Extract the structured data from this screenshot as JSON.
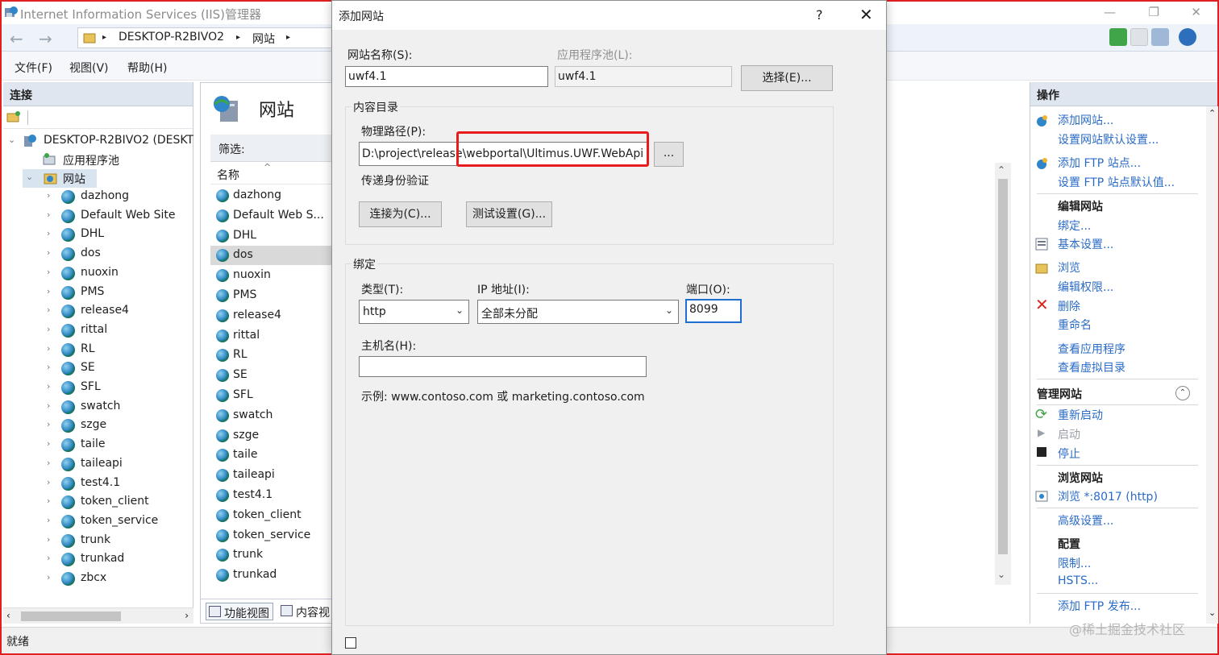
{
  "window": {
    "title": "Internet Information Services (IIS)管理器",
    "min": "—",
    "max": "❐",
    "close": "✕"
  },
  "address": {
    "back": "←",
    "forward": "→",
    "crumbs": [
      "DESKTOP-R2BIVO2",
      "网站"
    ],
    "sep": "▸"
  },
  "menu": [
    "文件(F)",
    "视图(V)",
    "帮助(H)"
  ],
  "connections": {
    "header": "连接",
    "server": "DESKTOP-R2BIVO2 (DESKT",
    "app_pools": "应用程序池",
    "sites_node": "网站",
    "sites": [
      "dazhong",
      "Default Web Site",
      "DHL",
      "dos",
      "nuoxin",
      "PMS",
      "release4",
      "rittal",
      "RL",
      "SE",
      "SFL",
      "swatch",
      "szge",
      "taile",
      "taileapi",
      "test4.1",
      "token_client",
      "token_service",
      "trunk",
      "trunkad",
      "zbcx"
    ]
  },
  "center": {
    "title": "网站",
    "filter_label": "筛选:",
    "column_name": "名称",
    "sites": [
      "dazhong",
      "Default Web S...",
      "DHL",
      "dos",
      "nuoxin",
      "PMS",
      "release4",
      "rittal",
      "RL",
      "SE",
      "SFL",
      "swatch",
      "szge",
      "taile",
      "taileapi",
      "test4.1",
      "token_client",
      "token_service",
      "trunk",
      "trunkad"
    ],
    "selected": "dos",
    "tab_features": "功能视图",
    "tab_content": "内容视"
  },
  "actions": {
    "header": "操作",
    "add_site": "添加网站...",
    "site_defaults": "设置网站默认设置...",
    "add_ftp": "添加 FTP 站点...",
    "ftp_defaults": "设置 FTP 站点默认值...",
    "edit_site": "编辑网站",
    "bindings": "绑定...",
    "basic_settings": "基本设置...",
    "browse": "浏览",
    "edit_permissions": "编辑权限...",
    "delete": "删除",
    "rename": "重命名",
    "view_apps": "查看应用程序",
    "view_vdirs": "查看虚拟目录",
    "manage_site": "管理网站",
    "restart": "重新启动",
    "start": "启动",
    "stop": "停止",
    "browse_site": "浏览网站",
    "browse_8017": "浏览 *:8017 (http)",
    "advanced": "高级设置...",
    "configure": "配置",
    "limits": "限制...",
    "hsts": "HSTS...",
    "add_ftp_publish": "添加 FTP 发布..."
  },
  "status": "就绪",
  "watermark": "@稀土掘金技术社区",
  "dialog": {
    "title": "添加网站",
    "help": "?",
    "close": "✕",
    "site_name_label": "网站名称(S):",
    "site_name": "uwf4.1",
    "app_pool_label": "应用程序池(L):",
    "app_pool": "uwf4.1",
    "select_button": "选择(E)...",
    "content_dir": "内容目录",
    "physical_path_label": "物理路径(P):",
    "physical_path": "D:\\project\\release\\webportal\\Ultimus.UWF.WebApi",
    "browse_button": "...",
    "passthrough_auth": "传递身份验证",
    "connect_as": "连接为(C)...",
    "test_settings": "测试设置(G)...",
    "binding": "绑定",
    "type_label": "类型(T):",
    "type": "http",
    "ip_label": "IP 地址(I):",
    "ip": "全部未分配",
    "port_label": "端口(O):",
    "port": "8099",
    "host_label": "主机名(H):",
    "host": "",
    "example": "示例: www.contoso.com 或 marketing.contoso.com"
  },
  "colors": {
    "accent": "#2a6bc6",
    "highlight_box": "#e81c1c",
    "window_border": "#e02020"
  }
}
